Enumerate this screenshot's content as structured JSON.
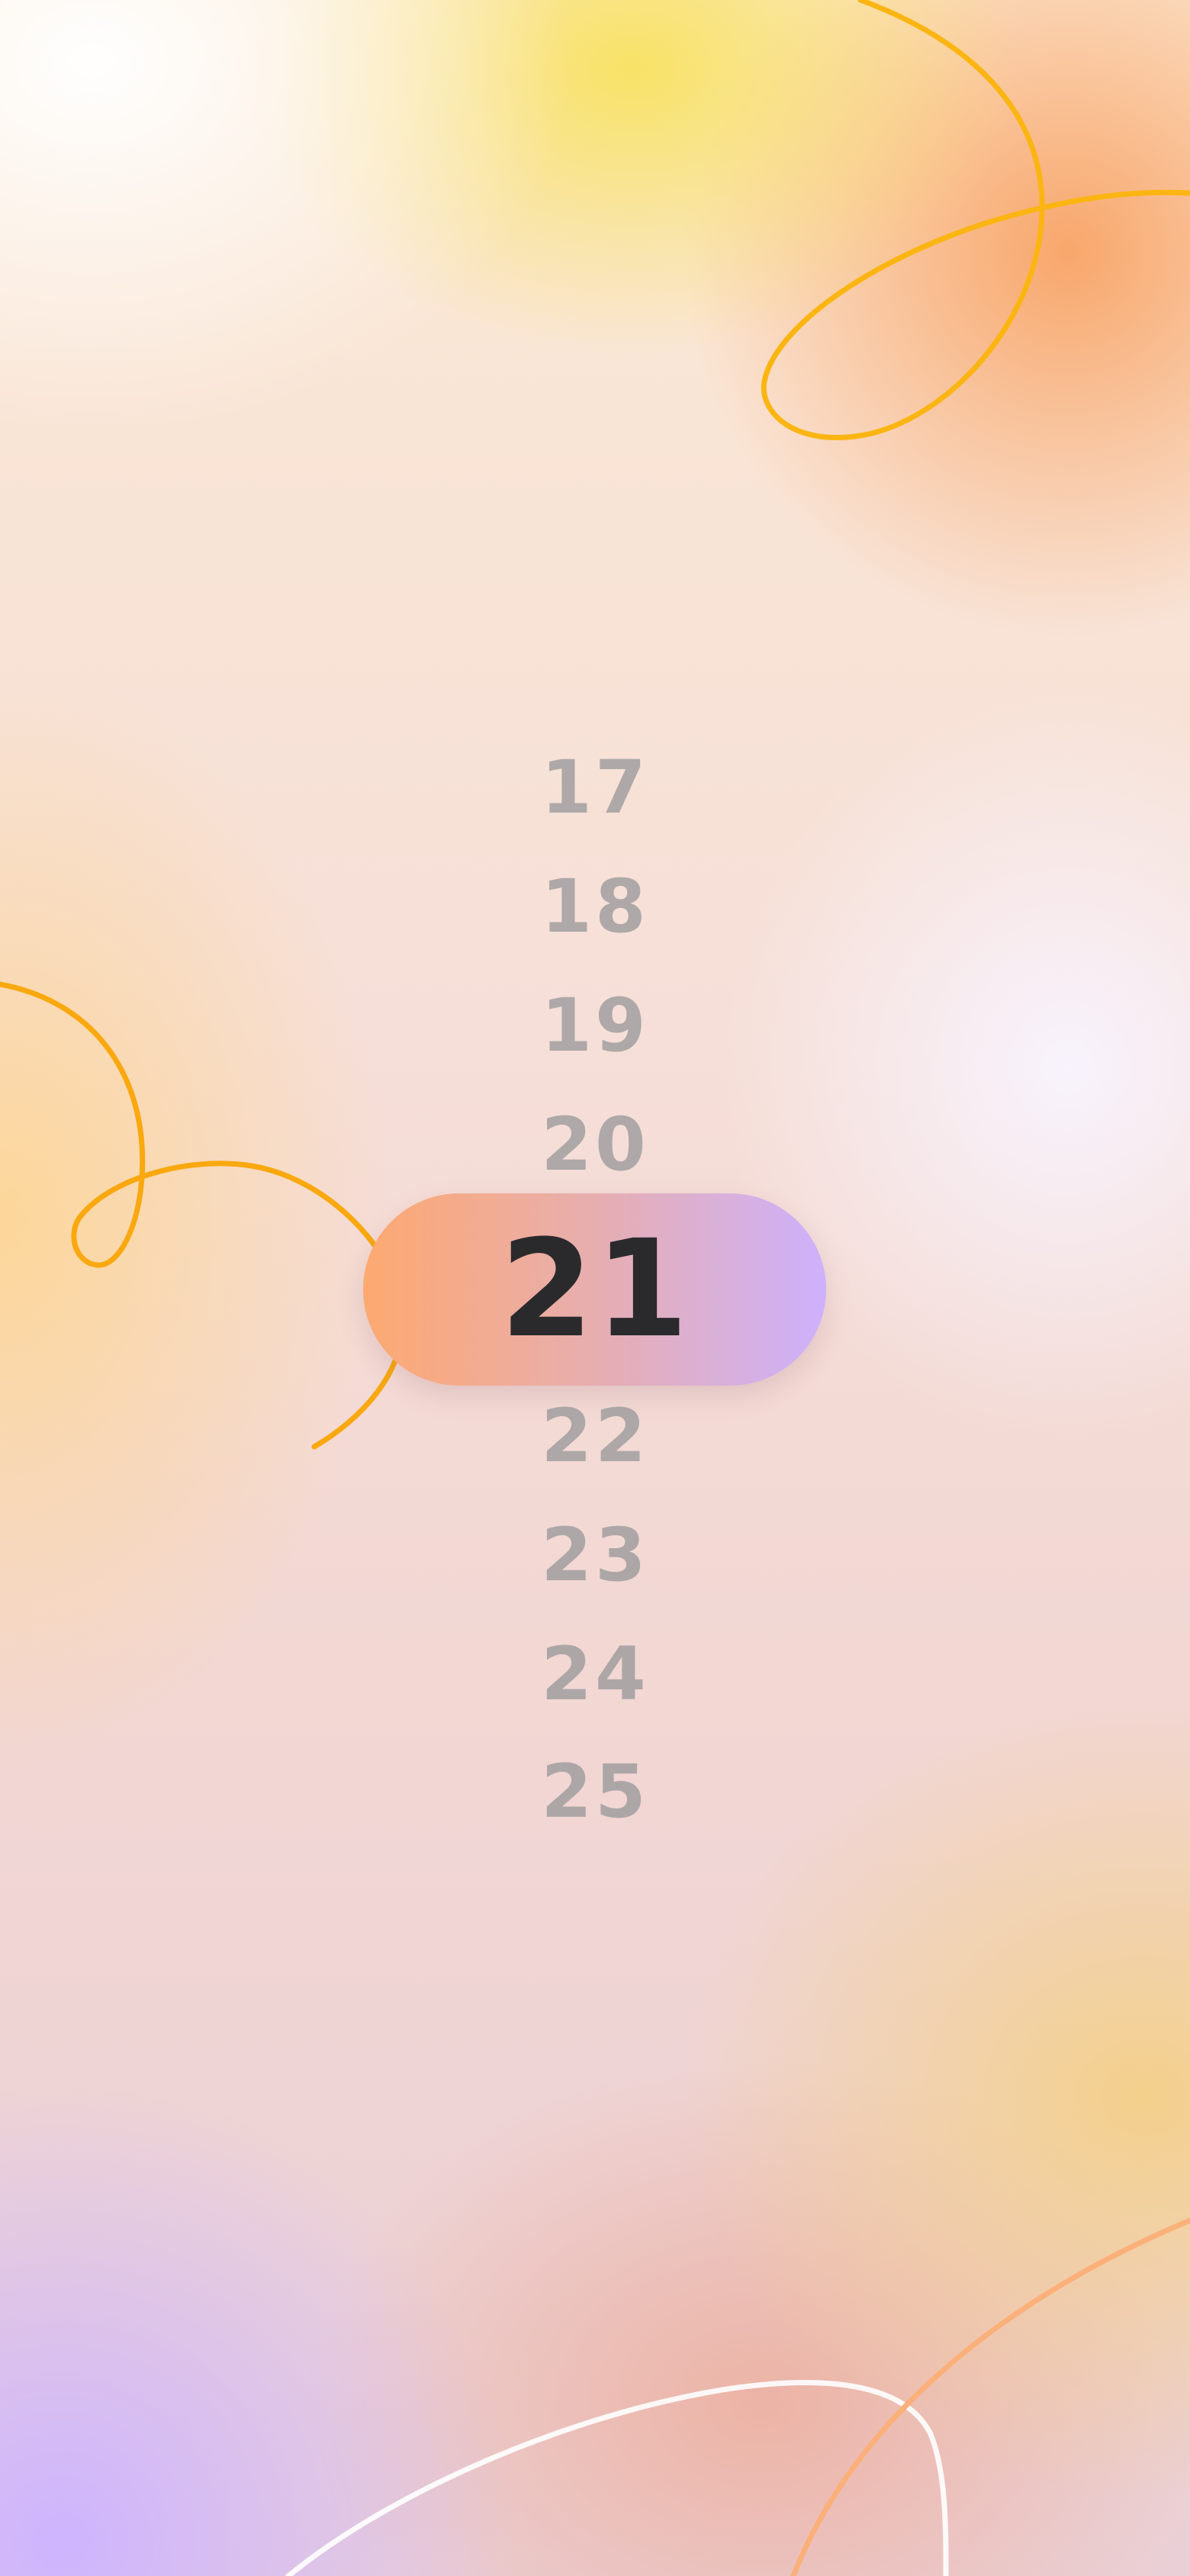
{
  "picker": {
    "items_above": [
      "17",
      "18",
      "19",
      "20"
    ],
    "selected": "21",
    "items_below": [
      "22",
      "23",
      "24",
      "25"
    ]
  },
  "colors": {
    "pill_gradient_start": "#fda971",
    "pill_gradient_end": "#cdb1fc",
    "selected_text": "#2a2a2c",
    "unselected_text": "#969698",
    "swirl_yellow": "#fbb512",
    "swirl_orange": "#f99a14"
  }
}
